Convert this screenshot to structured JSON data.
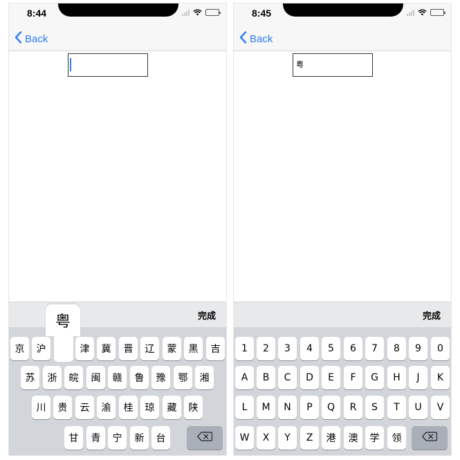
{
  "accent_color": "#2f7cf6",
  "left": {
    "status": {
      "time": "8:44"
    },
    "nav": {
      "back_label": "Back"
    },
    "field": {
      "value": ""
    },
    "toolbar": {
      "done_label": "完成"
    },
    "popup": {
      "char": "粤"
    },
    "rows": [
      [
        "京",
        "沪",
        "",
        "津",
        "冀",
        "晋",
        "辽",
        "蒙",
        "黑",
        "吉"
      ],
      [
        "苏",
        "浙",
        "皖",
        "闽",
        "赣",
        "鲁",
        "豫",
        "鄂",
        "湘"
      ],
      [
        "川",
        "贵",
        "云",
        "渝",
        "桂",
        "琼",
        "藏",
        "陕"
      ],
      [
        "甘",
        "青",
        "宁",
        "新",
        "台"
      ]
    ],
    "delete_icon": "backspace-icon"
  },
  "right": {
    "status": {
      "time": "8:45"
    },
    "nav": {
      "back_label": "Back"
    },
    "field": {
      "value": "粤"
    },
    "toolbar": {
      "done_label": "完成"
    },
    "rows": [
      [
        "1",
        "2",
        "3",
        "4",
        "5",
        "6",
        "7",
        "8",
        "9",
        "0"
      ],
      [
        "A",
        "B",
        "C",
        "D",
        "E",
        "F",
        "G",
        "H",
        "J",
        "K"
      ],
      [
        "L",
        "M",
        "N",
        "P",
        "Q",
        "R",
        "S",
        "T",
        "U",
        "V"
      ],
      [
        "W",
        "X",
        "Y",
        "Z",
        "港",
        "澳",
        "学",
        "领"
      ]
    ],
    "delete_icon": "backspace-icon"
  }
}
